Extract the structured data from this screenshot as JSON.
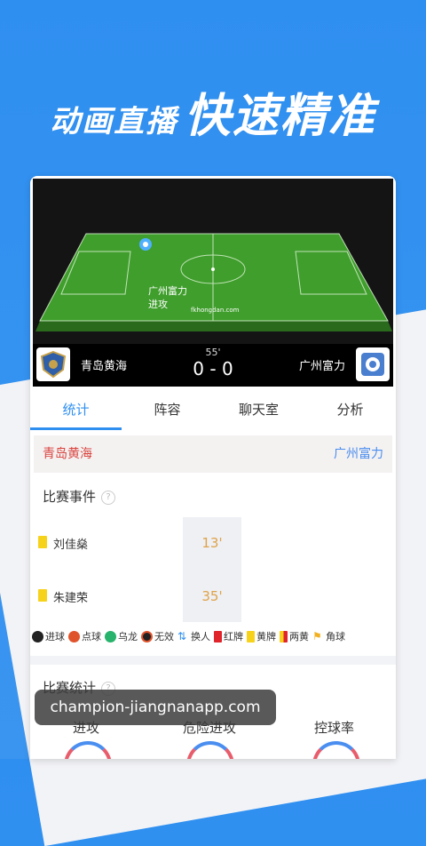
{
  "headline": {
    "part1": "动画直播",
    "part2": "快速精准"
  },
  "pitch": {
    "attack_team": "广州富力",
    "attack_label": "进攻",
    "site": "fkhongdan.com"
  },
  "match": {
    "minute": "55'",
    "score": "0 - 0",
    "home": "青岛黄海",
    "away": "广州富力"
  },
  "tabs": [
    {
      "label": "统计"
    },
    {
      "label": "阵容"
    },
    {
      "label": "聊天室"
    },
    {
      "label": "分析"
    }
  ],
  "teamrow": {
    "home": "青岛黄海",
    "away": "广州富力"
  },
  "events_section": {
    "title": "比赛事件",
    "help": "?"
  },
  "events": [
    {
      "player": "刘佳燊",
      "minute": "13'"
    },
    {
      "player": "朱建荣",
      "minute": "35'"
    }
  ],
  "legend": [
    {
      "label": "进球",
      "icon": "soccer-ball-icon"
    },
    {
      "label": "点球",
      "icon": "penalty-ball-icon"
    },
    {
      "label": "乌龙",
      "icon": "own-goal-ball-icon"
    },
    {
      "label": "无效",
      "icon": "invalid-goal-icon"
    },
    {
      "label": "换人",
      "icon": "substitution-icon"
    },
    {
      "label": "红牌",
      "icon": "red-card-icon"
    },
    {
      "label": "黄牌",
      "icon": "yellow-card-icon"
    },
    {
      "label": "两黄",
      "icon": "second-yellow-icon"
    },
    {
      "label": "角球",
      "icon": "corner-flag-icon"
    }
  ],
  "stats_section": {
    "title": "比赛统计",
    "help": "?"
  },
  "stats": [
    {
      "label": "进攻"
    },
    {
      "label": "危险进攻"
    },
    {
      "label": "控球率"
    }
  ],
  "watermark": "champion-jiangnanapp.com",
  "colors": {
    "accent": "#2f8ff0",
    "yellow_card": "#f7d21b",
    "red_card": "#e0242c",
    "minute": "#e0a24a",
    "team_home": "#d9443e",
    "team_away": "#4a8ef0"
  }
}
